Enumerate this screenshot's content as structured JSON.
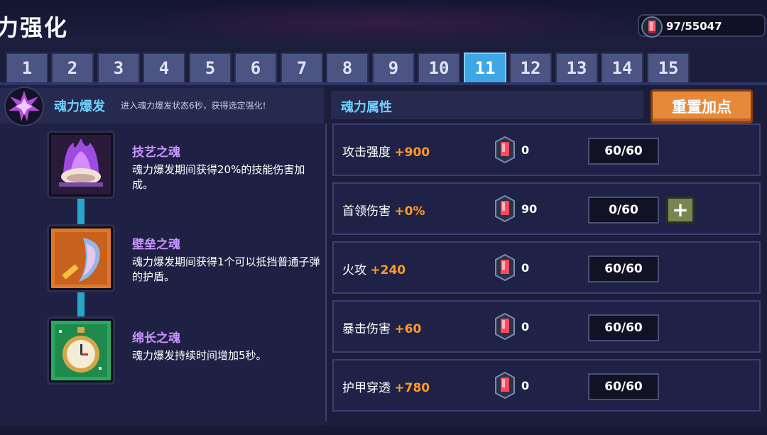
{
  "header": {
    "title": "力强化",
    "currency_value": "97/55047",
    "currency_icon": "soul-gem-icon"
  },
  "tabs": [
    {
      "label": "1"
    },
    {
      "label": "2"
    },
    {
      "label": "3"
    },
    {
      "label": "4"
    },
    {
      "label": "5"
    },
    {
      "label": "6"
    },
    {
      "label": "7"
    },
    {
      "label": "8"
    },
    {
      "label": "9"
    },
    {
      "label": "10"
    },
    {
      "label": "11",
      "active": true
    },
    {
      "label": "12"
    },
    {
      "label": "13"
    },
    {
      "label": "14"
    },
    {
      "label": "15"
    }
  ],
  "soul_burst": {
    "title": "魂力爆发",
    "description": "进入魂力爆发状态6秒，获得选定强化!",
    "nodes": [
      {
        "name": "技艺之魂",
        "description": "魂力爆发期间获得20%的技能伤害加成。",
        "icon": "purple-flame-shell-icon"
      },
      {
        "name": "壁垒之魂",
        "description": "魂力爆发期间获得1个可以抵挡普通子弹的护盾。",
        "icon": "shield-icon"
      },
      {
        "name": "绵长之魂",
        "description": "魂力爆发持续时间增加5秒。",
        "icon": "stopwatch-icon"
      }
    ]
  },
  "attributes": {
    "title": "魂力属性",
    "reset_label": "重置加点",
    "rows": [
      {
        "name": "攻击强度",
        "bonus": "+900",
        "cost": "0",
        "level": "60/60"
      },
      {
        "name": "首领伤害",
        "bonus": "+0%",
        "cost": "90",
        "level": "0/60",
        "plus": "+"
      },
      {
        "name": "火攻",
        "bonus": "+240",
        "cost": "0",
        "level": "60/60"
      },
      {
        "name": "暴击伤害",
        "bonus": "+60",
        "cost": "0",
        "level": "60/60"
      },
      {
        "name": "护甲穿透",
        "bonus": "+780",
        "cost": "0",
        "level": "60/60"
      }
    ]
  },
  "colors": {
    "accent_blue": "#6fd2ff",
    "bonus_orange": "#ff9a2a",
    "skill_purple": "#c893ff",
    "active_tab": "#3fa6e6",
    "reset_button": "#e68a3a"
  }
}
